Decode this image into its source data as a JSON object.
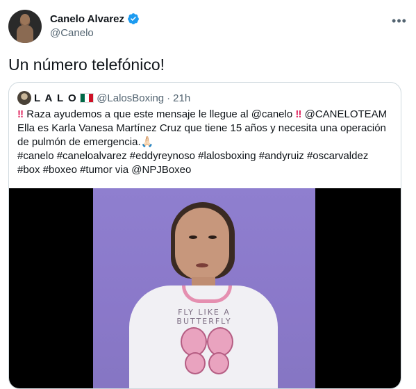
{
  "author": {
    "display_name": "Canelo Alvarez",
    "handle": "@Canelo",
    "verified": true
  },
  "tweet": {
    "text": "Un número telefónico!"
  },
  "quoted_tweet": {
    "display_name": "L A L O",
    "flag": "mexico-flag-icon",
    "handle": "@LalosBoxing",
    "separator": "·",
    "time": "21h",
    "lines": [
      {
        "bang1": "‼",
        "text": " Raza ayudemos a que este mensaje le llegue al @canelo ",
        "bang2": "‼",
        "text2": " @CANELOTEAM"
      },
      {
        "text": "Ella es Karla Vanesa Martínez Cruz que tiene 15 años y necesita una operación"
      },
      {
        "text": "de pulmón de emergencia.🙏🏻"
      },
      {
        "text": "#canelo #caneloalvarez #eddyreynoso #lalosboxing #andyruiz #oscarvaldez"
      },
      {
        "text": "#box #boxeo #tumor via @NPJBoxeo"
      }
    ]
  },
  "video": {
    "shirt_text": "FLY LIKE A BUTTERFLY"
  },
  "colors": {
    "accent": "#1d9bf0",
    "border": "#cfd9de",
    "muted_text": "#536471",
    "alert": "#e0245e"
  }
}
